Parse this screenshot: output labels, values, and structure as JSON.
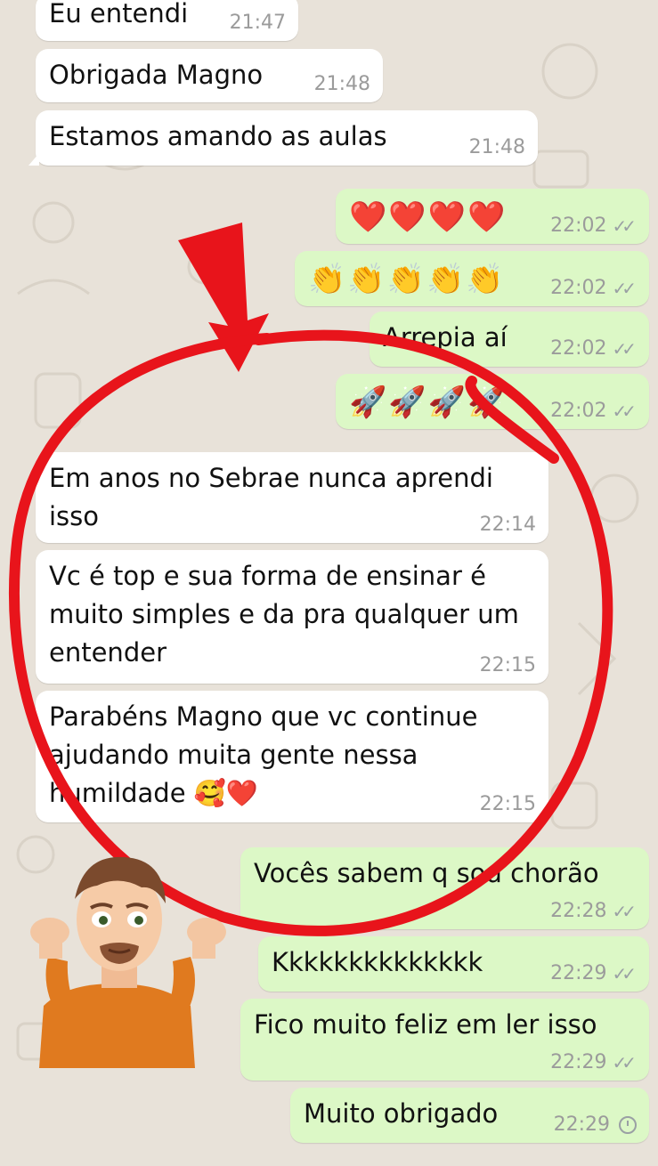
{
  "messages": [
    {
      "dir": "in",
      "text": "Eu entendi",
      "time": "21:47"
    },
    {
      "dir": "in",
      "text": "Obrigada Magno",
      "time": "21:48"
    },
    {
      "dir": "in",
      "text": "Estamos amando as aulas",
      "time": "21:48"
    },
    {
      "dir": "out",
      "text": "❤️❤️❤️❤️",
      "time": "22:02",
      "status": "read"
    },
    {
      "dir": "out",
      "text": "👏👏👏👏👏",
      "time": "22:02",
      "status": "read"
    },
    {
      "dir": "out",
      "text": "Arrepia aí",
      "time": "22:02",
      "status": "read"
    },
    {
      "dir": "out",
      "text": "🚀🚀🚀🚀",
      "time": "22:02",
      "status": "read"
    },
    {
      "dir": "in",
      "text": "Em anos no Sebrae nunca aprendi isso",
      "time": "22:14"
    },
    {
      "dir": "in",
      "text": "Vc é top e sua forma de ensinar é muito simples e da pra qualquer um entender",
      "time": "22:15"
    },
    {
      "dir": "in",
      "text": "Parabéns Magno que vc continue ajudando muita gente nessa humildade 🥰❤️",
      "time": "22:15"
    },
    {
      "dir": "out",
      "text": "Vocês sabem q sou chorão",
      "time": "22:28",
      "status": "read"
    },
    {
      "dir": "out",
      "text": "Kkkkkkkkkkkkkk",
      "time": "22:29",
      "status": "read"
    },
    {
      "dir": "out",
      "text": "Fico muito feliz em ler isso",
      "time": "22:29",
      "status": "read"
    },
    {
      "dir": "out",
      "text": "Muito obrigado",
      "time": "22:29",
      "status": "pending"
    }
  ],
  "colors": {
    "incoming_bubble": "#ffffff",
    "outgoing_bubble": "#dcf8c6",
    "annotation_red": "#e8141b",
    "wallpaper": "#e8e2d9"
  },
  "icons": {
    "read_status": "double-check-icon",
    "pending_status": "clock-icon"
  },
  "decorations": [
    "red-down-arrow",
    "red-circle-annotation",
    "shrugging-avatar-sticker"
  ]
}
